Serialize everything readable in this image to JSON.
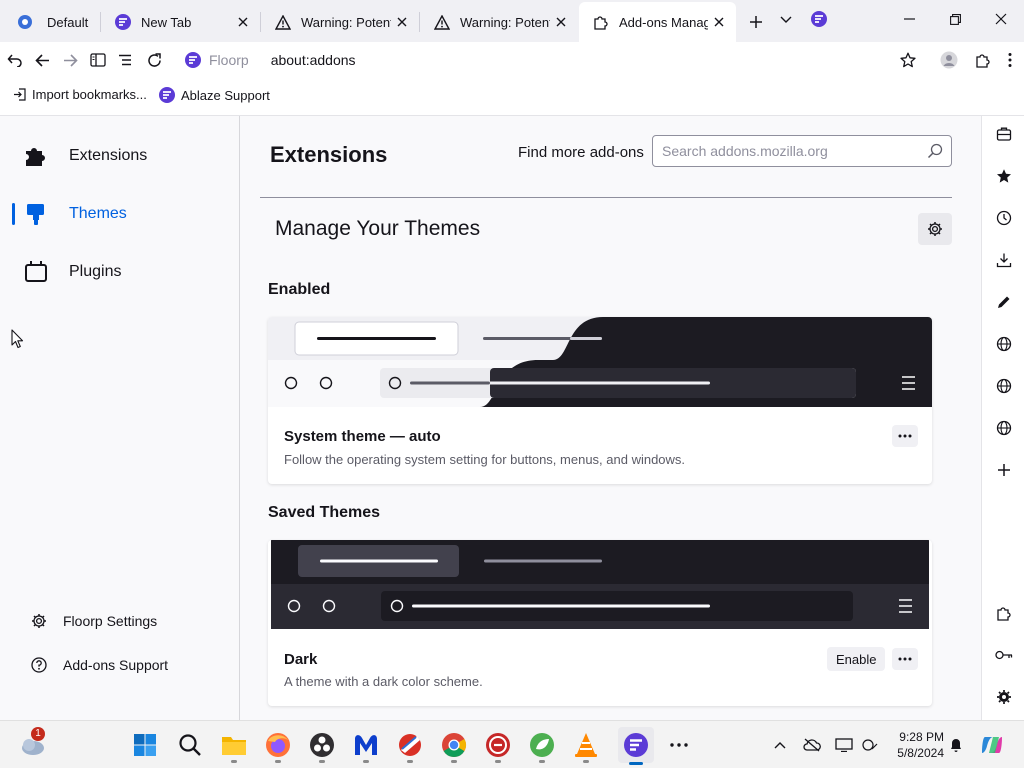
{
  "tabs": [
    {
      "label": "Default"
    },
    {
      "label": "New Tab"
    },
    {
      "label": "Warning: Potential Security Risk Ahead"
    },
    {
      "label": "Warning: Potential Security Risk Ahead"
    },
    {
      "label": "Add-ons Manager"
    }
  ],
  "navbar": {
    "identity": "Floorp",
    "url": "about:addons"
  },
  "bookmarks": [
    {
      "label": "Import bookmarks..."
    },
    {
      "label": "Ablaze Support"
    }
  ],
  "categories": [
    {
      "label": "Extensions"
    },
    {
      "label": "Themes"
    },
    {
      "label": "Plugins"
    }
  ],
  "category_footer": [
    {
      "label": "Floorp Settings"
    },
    {
      "label": "Add-ons Support"
    }
  ],
  "main": {
    "title": "Extensions",
    "find_more": "Find more add-ons",
    "search_placeholder": "Search addons.mozilla.org",
    "section_heading": "Manage Your Themes",
    "enabled_heading": "Enabled",
    "saved_heading": "Saved Themes",
    "enabled_theme": {
      "name": "System theme — auto",
      "description": "Follow the operating system setting for buttons, menus, and windows."
    },
    "saved_themes": [
      {
        "name": "Dark",
        "description": "A theme with a dark color scheme.",
        "enable_label": "Enable"
      }
    ]
  },
  "taskbar": {
    "weather_badge": "1",
    "time": "9:28 PM",
    "date": "5/8/2024"
  },
  "colors": {
    "accent": "#0061e0",
    "floorp_brand": "#5b3bd6",
    "dark_theme_bg": "#1c1b22"
  }
}
